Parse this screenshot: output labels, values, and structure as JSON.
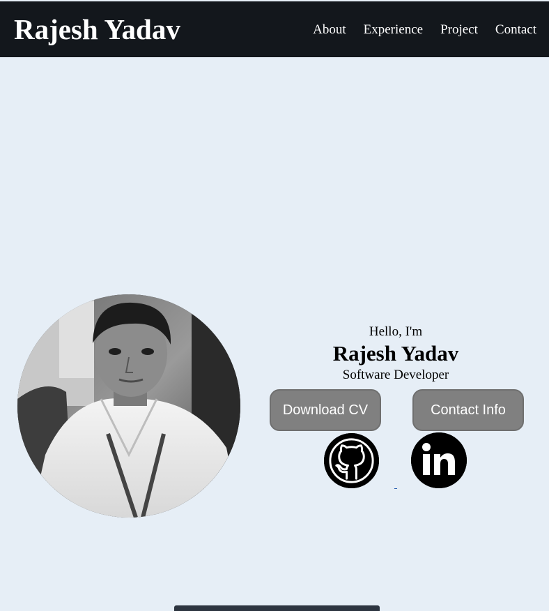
{
  "header": {
    "brand": "Rajesh Yadav",
    "nav": [
      {
        "label": "About"
      },
      {
        "label": "Experience"
      },
      {
        "label": "Project"
      },
      {
        "label": "Contact"
      }
    ]
  },
  "profile": {
    "image_alt": "profile-photo",
    "greeting": "Hello, I'm",
    "name": "Rajesh Yadav",
    "title": "Software Developer"
  },
  "buttons": {
    "download_cv": "Download CV",
    "contact_info": "Contact Info"
  },
  "socials": [
    {
      "name": "github",
      "icon": "github-icon"
    },
    {
      "name": "linkedin",
      "icon": "linkedin-icon",
      "text": "in"
    }
  ],
  "colors": {
    "navbar": "#13171c",
    "page_background": "#e6eef6",
    "button": "#808080"
  }
}
